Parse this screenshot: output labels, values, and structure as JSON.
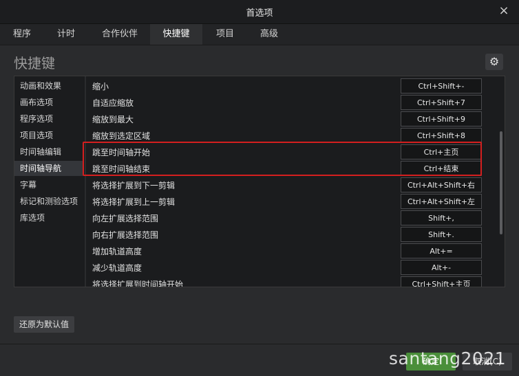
{
  "window": {
    "title": "首选项",
    "close_icon": "×"
  },
  "tabs": [
    {
      "label": "程序"
    },
    {
      "label": "计时"
    },
    {
      "label": "合作伙伴"
    },
    {
      "label": "快捷键"
    },
    {
      "label": "项目"
    },
    {
      "label": "高级"
    }
  ],
  "page": {
    "title": "快捷键",
    "gear_icon": "⚙"
  },
  "sidebar": {
    "items": [
      {
        "label": "动画和效果"
      },
      {
        "label": "画布选项"
      },
      {
        "label": "程序选项"
      },
      {
        "label": "项目选项"
      },
      {
        "label": "时间轴编辑"
      },
      {
        "label": "时间轴导航"
      },
      {
        "label": "字幕"
      },
      {
        "label": "标记和测验选项"
      },
      {
        "label": "库选项"
      }
    ]
  },
  "shortcuts": [
    {
      "command": "缩小",
      "key": "Ctrl+Shift+-"
    },
    {
      "command": "自适应缩放",
      "key": "Ctrl+Shift+7"
    },
    {
      "command": "缩放到最大",
      "key": "Ctrl+Shift+9"
    },
    {
      "command": "缩放到选定区域",
      "key": "Ctrl+Shift+8"
    },
    {
      "command": "跳至时间轴开始",
      "key": "Ctrl+主页"
    },
    {
      "command": "跳至时间轴结束",
      "key": "Ctrl+结束"
    },
    {
      "command": "将选择扩展到下一剪辑",
      "key": "Ctrl+Alt+Shift+右"
    },
    {
      "command": "将选择扩展到上一剪辑",
      "key": "Ctrl+Alt+Shift+左"
    },
    {
      "command": "向左扩展选择范围",
      "key": "Shift+,"
    },
    {
      "command": "向右扩展选择范围",
      "key": "Shift+."
    },
    {
      "command": "增加轨道高度",
      "key": "Alt+="
    },
    {
      "command": "减少轨道高度",
      "key": "Alt+-"
    },
    {
      "command": "将选择扩展到时间轴开始",
      "key": "Ctrl+Shift+主页"
    }
  ],
  "buttons": {
    "reset": "还原为默认值",
    "ok": "确定",
    "cancel": "取消(C)"
  },
  "watermark": "santang2021",
  "colors": {
    "highlight": "#d51f1f",
    "ok_button": "#4a8f3a",
    "selected_sidebar": "#34363a"
  }
}
